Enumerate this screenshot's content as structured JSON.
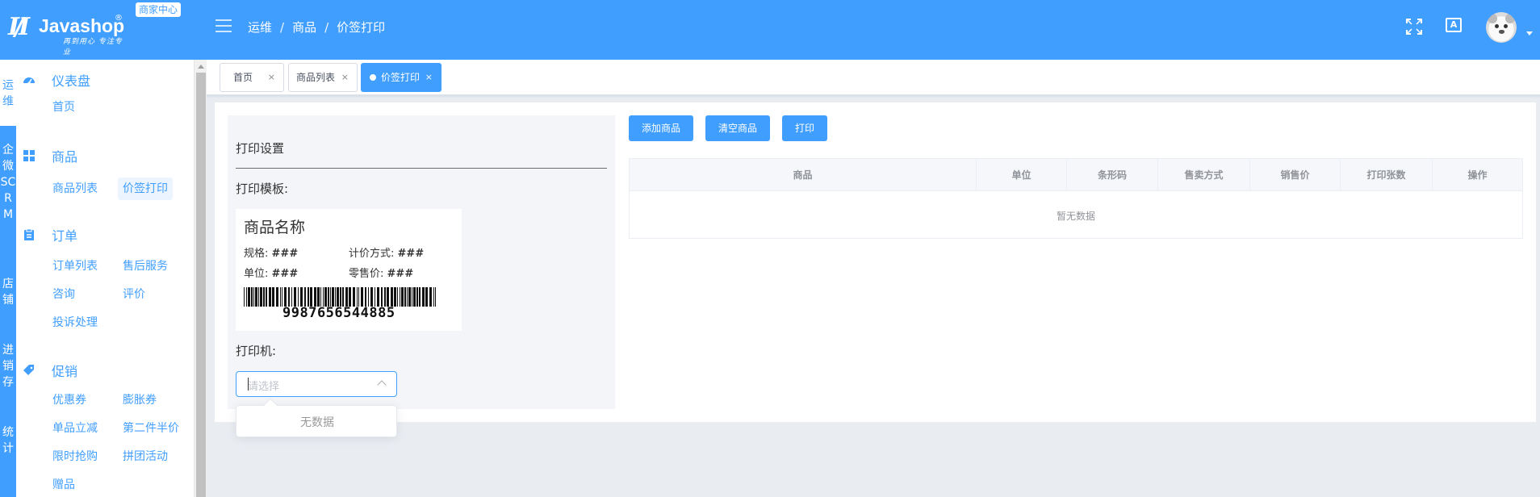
{
  "header": {
    "logo_text": "Javashop",
    "logo_reg": "®",
    "logo_slogan": "再到用心 专注专业",
    "merchant_badge": "商家中心",
    "breadcrumb": [
      "运维",
      "商品",
      "价签打印"
    ],
    "breadcrumb_sep": "/",
    "lang_icon_text": "A"
  },
  "rail": {
    "items": [
      "运维",
      "企微SCRM",
      "店铺",
      "进销存",
      "统计"
    ]
  },
  "sidebar": {
    "groups": [
      {
        "title": "仪表盘",
        "icon": "dashboard-icon",
        "links": [
          "首页"
        ]
      },
      {
        "title": "商品",
        "icon": "grid-icon",
        "links": [
          "商品列表",
          "价签打印"
        ]
      },
      {
        "title": "订单",
        "icon": "clipboard-icon",
        "links": [
          "订单列表",
          "售后服务",
          "咨询",
          "评价",
          "投诉处理"
        ]
      },
      {
        "title": "促销",
        "icon": "tag-icon",
        "links": [
          "优惠券",
          "膨胀券",
          "单品立减",
          "第二件半价",
          "限时抢购",
          "拼团活动",
          "赠品"
        ]
      }
    ]
  },
  "tabs": [
    {
      "label": "首页",
      "close": "×"
    },
    {
      "label": "商品列表",
      "close": "×"
    },
    {
      "label": "价签打印",
      "close": "×"
    }
  ],
  "settings": {
    "title": "打印设置",
    "template_label": "打印模板:",
    "printer_label": "打印机:",
    "printer_placeholder": "请选择",
    "dropdown_empty": "无数据"
  },
  "template": {
    "name": "商品名称",
    "spec_label": "规格:",
    "spec_value": "###",
    "pricing_label": "计价方式:",
    "pricing_value": "###",
    "unit_label": "单位:",
    "unit_value": "###",
    "price_label": "零售价:",
    "price_value": "###",
    "barcode": "9987656544885"
  },
  "buttons": {
    "add": "添加商品",
    "clear": "清空商品",
    "print": "打印"
  },
  "table": {
    "headers": [
      "商品",
      "单位",
      "条形码",
      "售卖方式",
      "销售价",
      "打印张数",
      "操作"
    ],
    "empty": "暂无数据"
  }
}
